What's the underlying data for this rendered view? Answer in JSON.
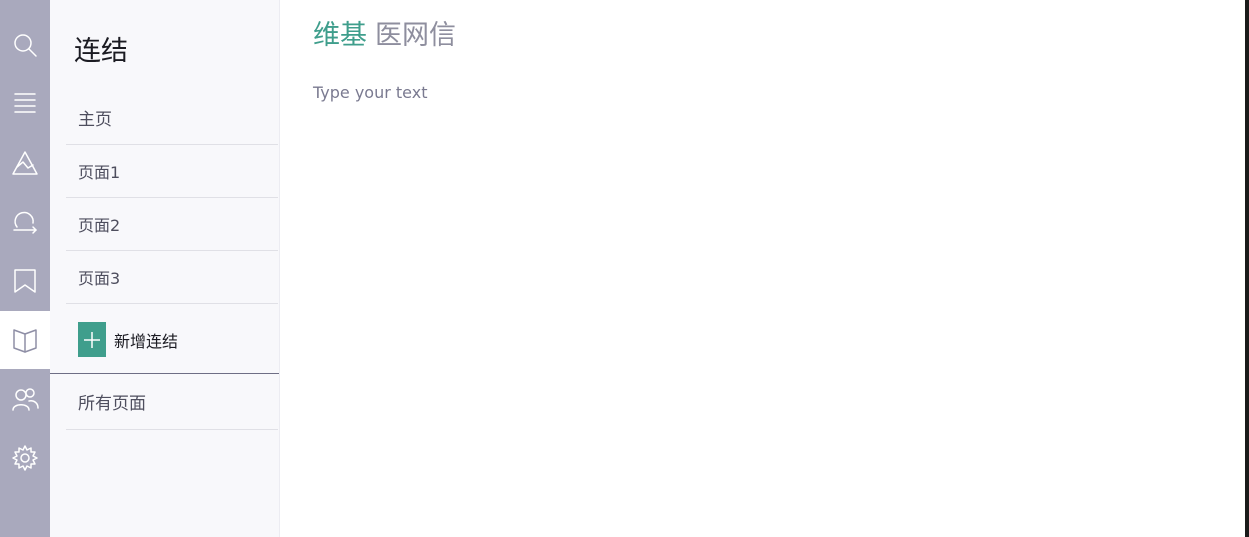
{
  "rail": {
    "items": [
      {
        "icon": "search-icon"
      },
      {
        "icon": "menu-icon"
      },
      {
        "icon": "mountain-icon"
      },
      {
        "icon": "refresh-icon"
      },
      {
        "icon": "bookmark-icon"
      },
      {
        "icon": "book-icon",
        "active": true
      },
      {
        "icon": "users-icon"
      },
      {
        "icon": "gear-icon"
      }
    ],
    "colors": {
      "background": "#a9a9bd",
      "active_background": "#ffffff"
    }
  },
  "panel": {
    "title": "连结",
    "links": [
      {
        "label": "主页"
      },
      {
        "label": "页面1"
      },
      {
        "label": "页面2"
      },
      {
        "label": "页面3"
      }
    ],
    "add_link_label": "新增连结",
    "all_pages_label": "所有页面"
  },
  "main": {
    "heading_brand": "维基",
    "heading_rest": "医网信",
    "editor_placeholder": "Type your text"
  },
  "colors": {
    "accent": "#3f9e8c",
    "heading_secondary": "#8e8e9e"
  }
}
